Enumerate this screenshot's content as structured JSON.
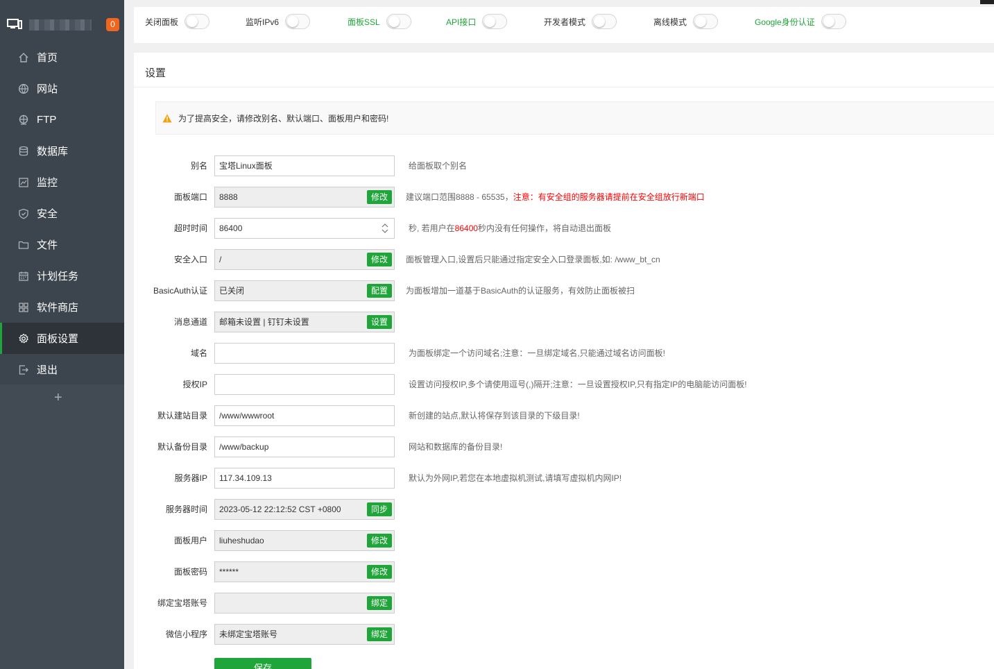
{
  "sidebar": {
    "badge": "0",
    "items": [
      {
        "label": "首页",
        "icon": "home-icon"
      },
      {
        "label": "网站",
        "icon": "globe-icon"
      },
      {
        "label": "FTP",
        "icon": "ftp-icon"
      },
      {
        "label": "数据库",
        "icon": "database-icon"
      },
      {
        "label": "监控",
        "icon": "monitor-chart-icon"
      },
      {
        "label": "安全",
        "icon": "shield-icon"
      },
      {
        "label": "文件",
        "icon": "folder-icon"
      },
      {
        "label": "计划任务",
        "icon": "calendar-icon"
      },
      {
        "label": "软件商店",
        "icon": "apps-icon"
      },
      {
        "label": "面板设置",
        "icon": "gear-icon"
      },
      {
        "label": "退出",
        "icon": "logout-icon"
      }
    ],
    "active": "面板设置",
    "add_label": "+"
  },
  "toggles": [
    {
      "label": "关闭面板",
      "green": false
    },
    {
      "label": "监听IPv6",
      "green": false
    },
    {
      "label": "面板SSL",
      "green": true
    },
    {
      "label": "API接口",
      "green": true
    },
    {
      "label": "开发者模式",
      "green": false
    },
    {
      "label": "离线模式",
      "green": false
    },
    {
      "label": "Google身份认证",
      "green": true
    }
  ],
  "panel": {
    "title": "设置",
    "warning": "为了提高安全，请修改别名、默认端口、面板用户和密码!",
    "save_label": "保存"
  },
  "settings": {
    "alias": {
      "label": "别名",
      "value": "宝塔Linux面板",
      "tip": "给面板取个别名"
    },
    "port": {
      "label": "面板端口",
      "value": "8888",
      "button": "修改",
      "tip": "建议端口范围8888 - 65535，",
      "tip_red": "注意：有安全组的服务器请提前在安全组放行新端口"
    },
    "timeout": {
      "label": "超时时间",
      "value": "86400",
      "tip_pre": "秒, 若用户在",
      "tip_red": "86400",
      "tip_post": "秒内没有任何操作，将自动退出面板"
    },
    "entry": {
      "label": "安全入口",
      "value": "/",
      "button": "修改",
      "tip": "面板管理入口,设置后只能通过指定安全入口登录面板,如: /www_bt_cn"
    },
    "basicauth": {
      "label": "BasicAuth认证",
      "value": "已关闭",
      "button": "配置",
      "tip": "为面板增加一道基于BasicAuth的认证服务，有效防止面板被扫"
    },
    "message": {
      "label": "消息通道",
      "value": "邮箱未设置 | 钉钉未设置",
      "button": "设置"
    },
    "domain": {
      "label": "域名",
      "value": "",
      "tip": "为面板绑定一个访问域名;注意：一旦绑定域名,只能通过域名访问面板!"
    },
    "auth_ip": {
      "label": "授权IP",
      "value": "",
      "tip": "设置访问授权IP,多个请使用逗号(,)隔开;注意：一旦设置授权IP,只有指定IP的电脑能访问面板!"
    },
    "site_dir": {
      "label": "默认建站目录",
      "value": "/www/wwwroot",
      "tip": "新创建的站点,默认将保存到该目录的下级目录!"
    },
    "backup_dir": {
      "label": "默认备份目录",
      "value": "/www/backup",
      "tip": "网站和数据库的备份目录!"
    },
    "server_ip": {
      "label": "服务器IP",
      "value": "117.34.109.13",
      "tip": "默认为外网IP,若您在本地虚拟机测试,请填写虚拟机内网IP!"
    },
    "server_time": {
      "label": "服务器时间",
      "value": "2023-05-12 22:12:52 CST +0800",
      "button": "同步"
    },
    "user": {
      "label": "面板用户",
      "value": "liuheshudao",
      "button": "修改"
    },
    "password": {
      "label": "面板密码",
      "value": "******",
      "button": "修改"
    },
    "bt_account": {
      "label": "绑定宝塔账号",
      "value": "",
      "button": "绑定"
    },
    "wechat": {
      "label": "微信小程序",
      "value": "未绑定宝塔账号",
      "button": "绑定"
    }
  },
  "colors": {
    "accent": "#20a53a",
    "sidebar": "#3c444d",
    "badge": "#f0661f",
    "warning": "#f0a30a"
  }
}
